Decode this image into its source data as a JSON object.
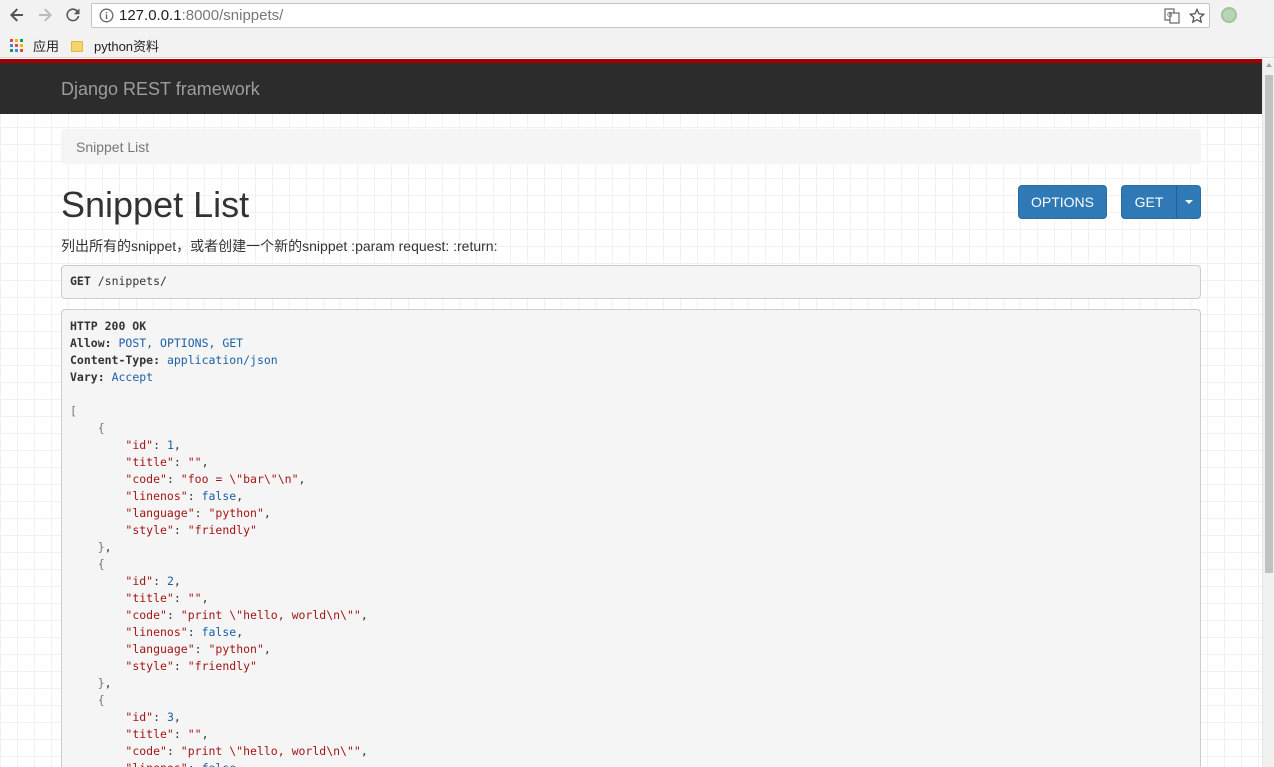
{
  "browser": {
    "url_host": "127.0.0.1",
    "url_rest": ":8000/snippets/",
    "bookmarks": [
      {
        "label": "应用",
        "icon": "apps-grid-icon"
      },
      {
        "label": "python资料",
        "icon": "folder-icon"
      }
    ]
  },
  "navbar": {
    "brand": "Django REST framework"
  },
  "breadcrumb": {
    "items": [
      "Snippet List"
    ]
  },
  "page": {
    "title": "Snippet List",
    "description": "列出所有的snippet，或者创建一个新的snippet :param request: :return:",
    "options_label": "OPTIONS",
    "get_label": "GET"
  },
  "request": {
    "method": "GET",
    "path": "/snippets/"
  },
  "response": {
    "status": "HTTP 200 OK",
    "headers": [
      {
        "name": "Allow",
        "value": "POST, OPTIONS, GET"
      },
      {
        "name": "Content-Type",
        "value": "application/json"
      },
      {
        "name": "Vary",
        "value": "Accept"
      }
    ],
    "body": [
      {
        "id": 1,
        "title": "",
        "code": "foo = \\\"bar\\\"\\n",
        "linenos": false,
        "language": "python",
        "style": "friendly"
      },
      {
        "id": 2,
        "title": "",
        "code": "print \\\"hello, world\\n\\\"",
        "linenos": false,
        "language": "python",
        "style": "friendly"
      },
      {
        "id": 3,
        "title": "",
        "code": "print \\\"hello, world\\n\\\"",
        "linenos": false
      }
    ]
  },
  "colors": {
    "navbar_bg": "#2c2c2c",
    "navbar_accent": "#a30000",
    "button_primary": "#2f79b6",
    "json_key": "#a31515",
    "json_number": "#1b60a8"
  }
}
